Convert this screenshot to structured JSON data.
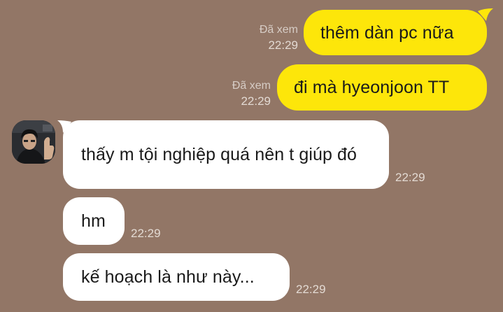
{
  "conversation": {
    "messages": [
      {
        "direction": "outgoing",
        "text": "thêm dàn pc nữa",
        "status": "Đã xem",
        "time": "22:29"
      },
      {
        "direction": "outgoing",
        "text": "đi mà hyeonjoon TT",
        "status": "Đã xem",
        "time": "22:29"
      },
      {
        "direction": "incoming",
        "text": "thấy m tội nghiệp quá nên t giúp đó",
        "time": "22:29"
      },
      {
        "direction": "incoming",
        "text": "hm",
        "time": "22:29"
      },
      {
        "direction": "incoming",
        "text": "kế hoạch là như này...",
        "time": "22:29"
      }
    ]
  },
  "contact": {
    "avatar_icon": "user-avatar-photo"
  },
  "colors": {
    "background": "#927666",
    "outgoing_bubble": "#fde60a",
    "incoming_bubble": "#ffffff"
  }
}
